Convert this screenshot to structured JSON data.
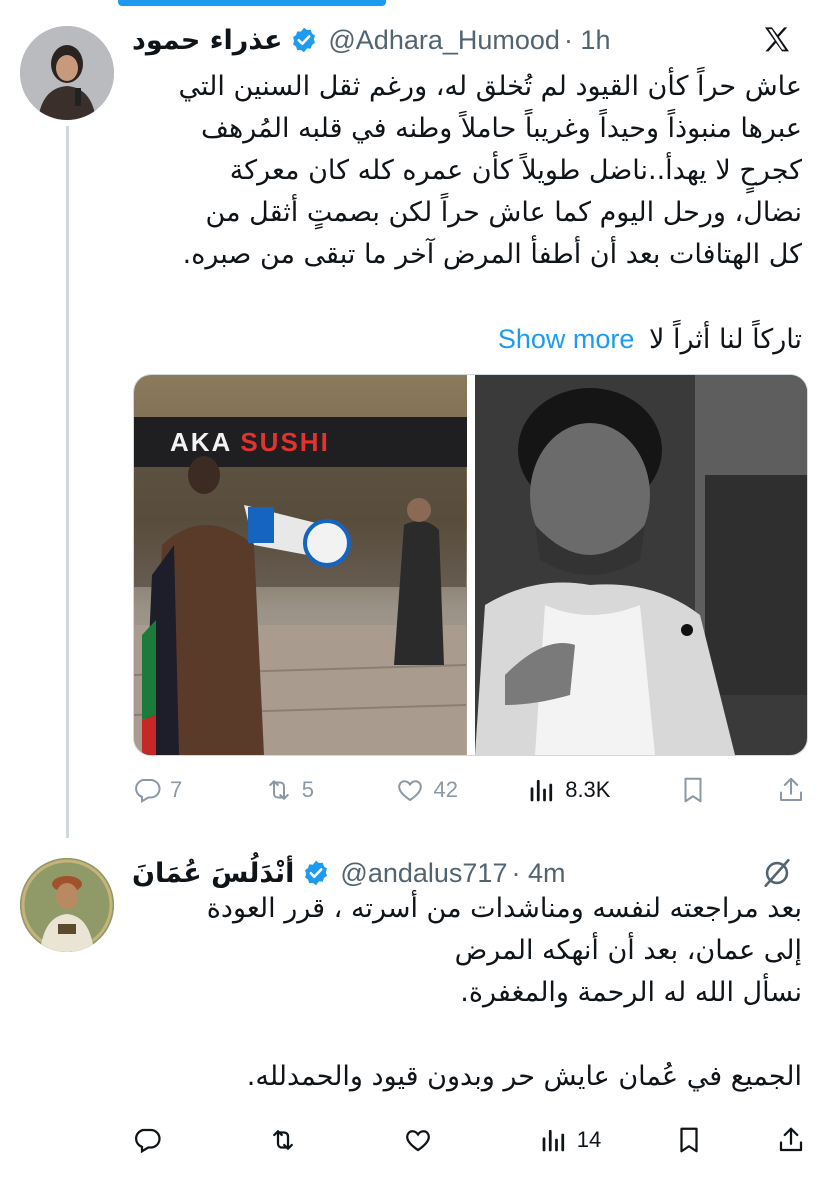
{
  "tweets": [
    {
      "author": {
        "name": "عذراء حمود",
        "handle": "@Adhara_Humood",
        "time": "· 1h",
        "verified": true
      },
      "platform_icon": "x-logo-icon",
      "text_lines": [
        "عاش حراً كأن القيود لم تُخلق له، ورغم ثقل السنين التي",
        "عبرها منبوذاً وحيداً وغريباً حاملاً وطنه في قلبه المُرهف",
        "كجرحٍ لا يهدأ..ناضل طويلاً كأن عمره كله كان معركة",
        "نضال، ورحل اليوم كما عاش حراً لكن بصمتٍ أثقل من",
        "كل الهتافات بعد أن أطفأ المرض آخر ما تبقى من صبره."
      ],
      "last_line": "تاركاً لنا أثراً لا",
      "show_more": "Show more",
      "media": {
        "left_sign": {
          "aka": "AKA",
          "sushi": "SUSHI"
        }
      },
      "stats": {
        "replies": "7",
        "reposts": "5",
        "likes": "42",
        "views": "8.3K"
      }
    },
    {
      "author": {
        "name": "أنْدَلُسَ عُمَانَ",
        "handle": "@andalus717",
        "time": "· 4m",
        "verified": true
      },
      "header_icon": "grok-icon",
      "text_lines": [
        "بعد مراجعته لنفسه ومناشدات من أسرته ، قرر العودة",
        "إلى عمان، بعد أن أنهكه المرض",
        "نسأل الله له الرحمة والمغفرة.",
        "",
        "الجميع في عُمان عايش حر  وبدون قيود والحمدلله."
      ],
      "stats": {
        "views": "14"
      }
    }
  ],
  "colors": {
    "accent": "#1d9bf0",
    "muted": "#536471",
    "icon_muted": "#8b98a5",
    "text": "#0f1419"
  }
}
